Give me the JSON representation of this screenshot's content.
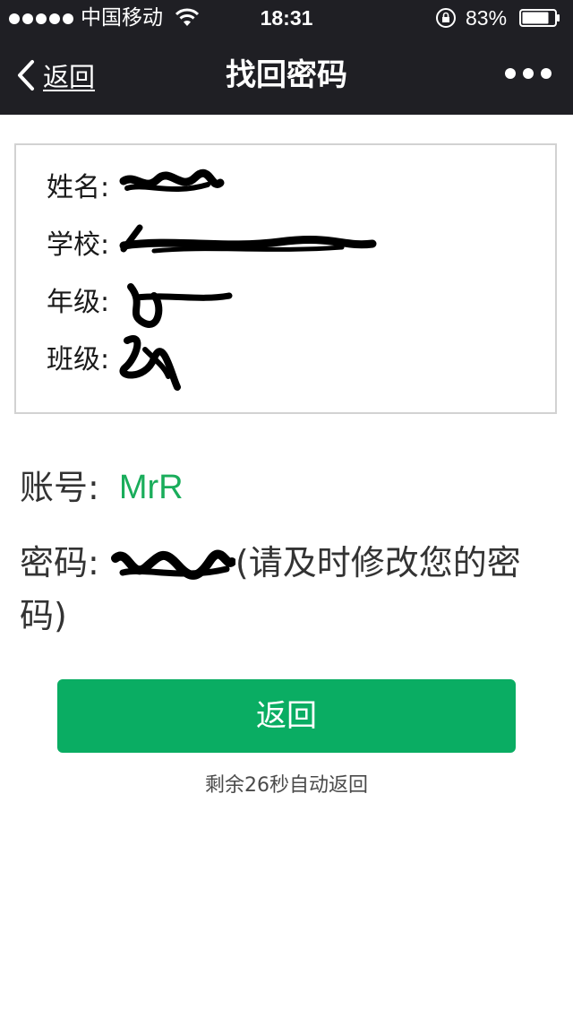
{
  "status_bar": {
    "carrier": "中国移动",
    "time": "18:31",
    "battery_percent": "83%",
    "battery_level": 0.83,
    "signal_bars": 5
  },
  "nav": {
    "back_label": "返回",
    "title": "找回密码"
  },
  "info": {
    "name_label": "姓名:",
    "school_label": "学校:",
    "grade_label": "年级:",
    "class_label": "班级:"
  },
  "account": {
    "label": "账号:",
    "value": "MrR"
  },
  "password": {
    "label": "密码:",
    "note": "(请及时修改您的密码)"
  },
  "return_button": {
    "label": "返回"
  },
  "countdown": {
    "text": "剩余26秒自动返回"
  },
  "colors": {
    "topbar": "#1f1f24",
    "accent_green": "#0aad63",
    "account_green": "#1aad5b",
    "card_border": "#d2d2d2"
  }
}
